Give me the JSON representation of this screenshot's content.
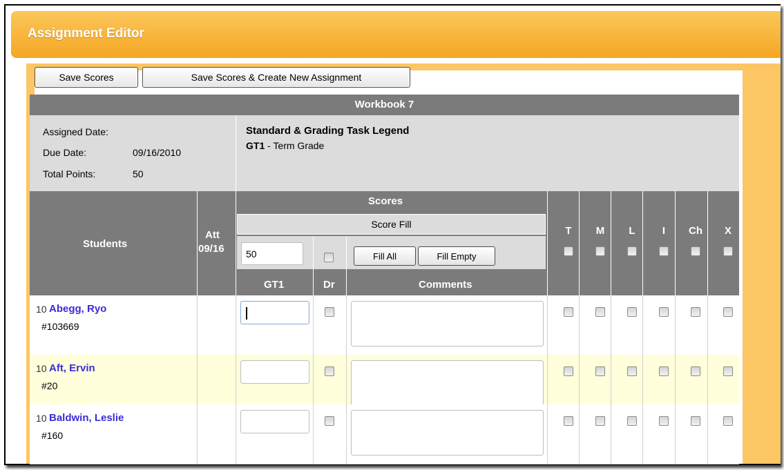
{
  "window": {
    "title": "Assignment Editor"
  },
  "toolbar": {
    "save_label": "Save Scores",
    "save_new_label": "Save Scores & Create New Assignment"
  },
  "assignment": {
    "name": "Workbook 7",
    "assigned_date_label": "Assigned Date:",
    "assigned_date_value": "",
    "due_date_label": "Due Date:",
    "due_date_value": "09/16/2010",
    "total_points_label": "Total Points:",
    "total_points_value": "50"
  },
  "legend": {
    "title": "Standard & Grading Task Legend",
    "code": "GT1",
    "description": " - Term Grade"
  },
  "columns": {
    "students": "Students",
    "att": "Att",
    "att_date": "09/16",
    "scores": "Scores",
    "score_fill": "Score Fill",
    "gt1": "GT1",
    "dr": "Dr",
    "comments": "Comments",
    "flags": [
      "T",
      "M",
      "L",
      "I",
      "Ch",
      "X"
    ]
  },
  "score_fill": {
    "value": "50",
    "fill_all_label": "Fill All",
    "fill_empty_label": "Fill Empty"
  },
  "students": [
    {
      "grade": "10",
      "name": "Abegg, Ryo",
      "id": "#103669",
      "score": "",
      "comment": ""
    },
    {
      "grade": "10",
      "name": "Aft, Ervin",
      "id": "#20",
      "score": "",
      "comment": ""
    },
    {
      "grade": "10",
      "name": "Baldwin, Leslie",
      "id": "#160",
      "score": "",
      "comment": ""
    }
  ],
  "colors": {
    "header": "#7b7b7b",
    "accent": "#f5a623",
    "name_link": "#3b2bd8",
    "alt_row": "#ffffdc"
  }
}
